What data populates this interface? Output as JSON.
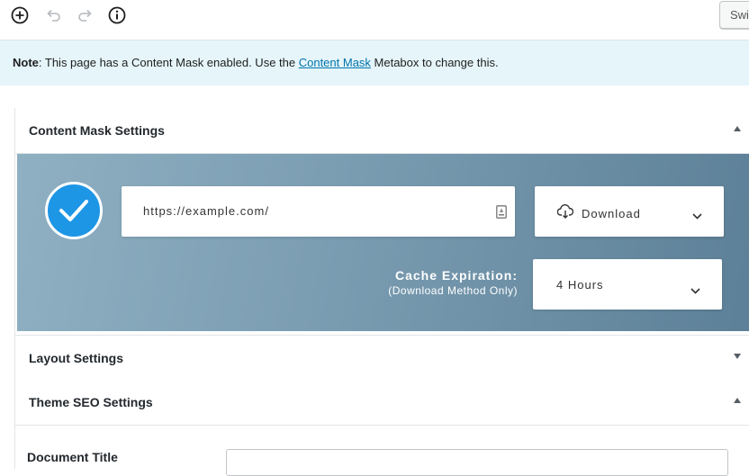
{
  "toolbar": {
    "switch_label": "Swi"
  },
  "notice": {
    "prefix": "Note",
    "text_before": ": This page has a Content Mask enabled. Use the ",
    "link_text": "Content Mask",
    "text_after": " Metabox to change this."
  },
  "content_mask": {
    "title": "Content Mask Settings",
    "url_value": "https://example.com/",
    "method_value": "Download",
    "cache_label": "Cache Expiration:",
    "cache_sublabel": "(Download Method Only)",
    "cache_value": "4 Hours"
  },
  "sections": {
    "layout": "Layout Settings",
    "theme_seo": "Theme SEO Settings"
  },
  "seo": {
    "document_title_label": "Document Title",
    "document_title_value": ""
  },
  "colors": {
    "check_blue": "#1e96e6",
    "notice_bg": "#e5f5fa",
    "link": "#0073aa"
  }
}
